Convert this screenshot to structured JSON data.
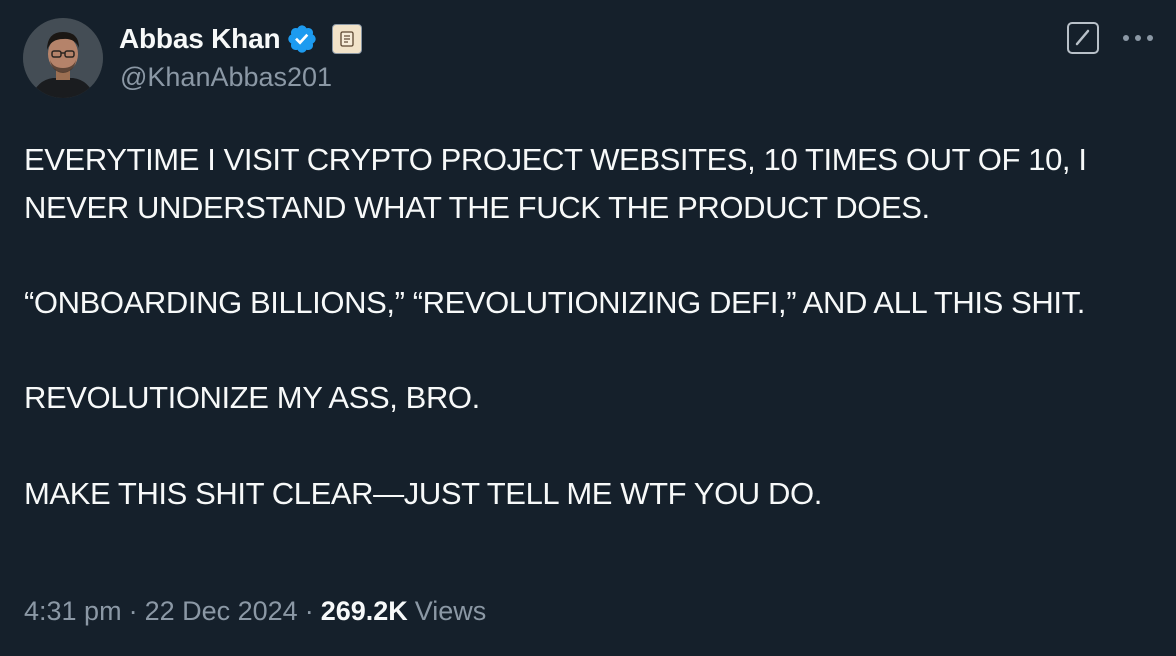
{
  "author": {
    "display_name": "Abbas Khan",
    "handle": "@KhanAbbas201",
    "verified": true,
    "affiliate_badge_icon": "scroll-icon",
    "avatar_icon": "profile-photo"
  },
  "actions": {
    "grok_icon": "grok-icon",
    "more_icon": "more-dots-icon"
  },
  "tweet": {
    "paragraphs": [
      "EVERYTIME I VISIT CRYPTO PROJECT WEBSITES, 10 TIMES OUT OF 10, I NEVER UNDERSTAND WHAT THE FUCK THE PRODUCT DOES.",
      "“ONBOARDING BILLIONS,” “REVOLUTIONIZING DEFI,” AND ALL THIS SHIT.",
      "REVOLUTIONIZE MY ASS, BRO.",
      "MAKE THIS SHIT CLEAR—JUST TELL ME WTF YOU DO."
    ]
  },
  "meta": {
    "time": "4:31 pm",
    "separator": "·",
    "date": "22 Dec 2024",
    "views_count": "269.2K",
    "views_label": "Views"
  },
  "colors": {
    "background": "#15202b",
    "primary_text": "#f7f9f9",
    "secondary_text": "#8b98a5",
    "verified_blue": "#1d9bf0"
  }
}
